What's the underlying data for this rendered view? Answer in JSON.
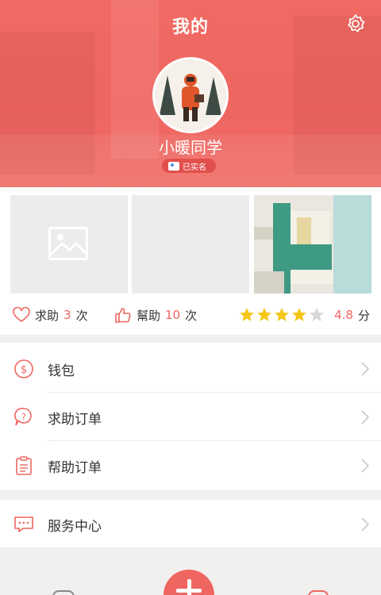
{
  "header": {
    "title": "我的",
    "username": "小暖同学",
    "verified_label": "已实名",
    "settings_icon": "gear-icon",
    "accent": "#ef6560"
  },
  "photos": [
    {
      "kind": "placeholder",
      "icon": "image-placeholder-icon"
    },
    {
      "kind": "blank"
    },
    {
      "kind": "photo",
      "description_icon": "building-photo"
    }
  ],
  "stats": {
    "help_requests": {
      "label": "求助",
      "count": "3",
      "unit": "次",
      "icon": "heart-icon"
    },
    "helps_given": {
      "label": "幫助",
      "count": "10",
      "unit": "次",
      "icon": "thumbs-up-icon"
    },
    "rating": {
      "stars_filled": 4,
      "stars_total": 5,
      "value": "4.8",
      "unit": "分"
    }
  },
  "menu": {
    "wallet": "钱包",
    "help_orders": "求助订单",
    "assist_orders": "帮助订单",
    "service_center": "服务中心"
  },
  "colors": {
    "header_bg": "#ef6560",
    "star_filled": "#f5c518",
    "star_empty": "#d8d8d8",
    "icon_stroke": "#ef6560"
  }
}
